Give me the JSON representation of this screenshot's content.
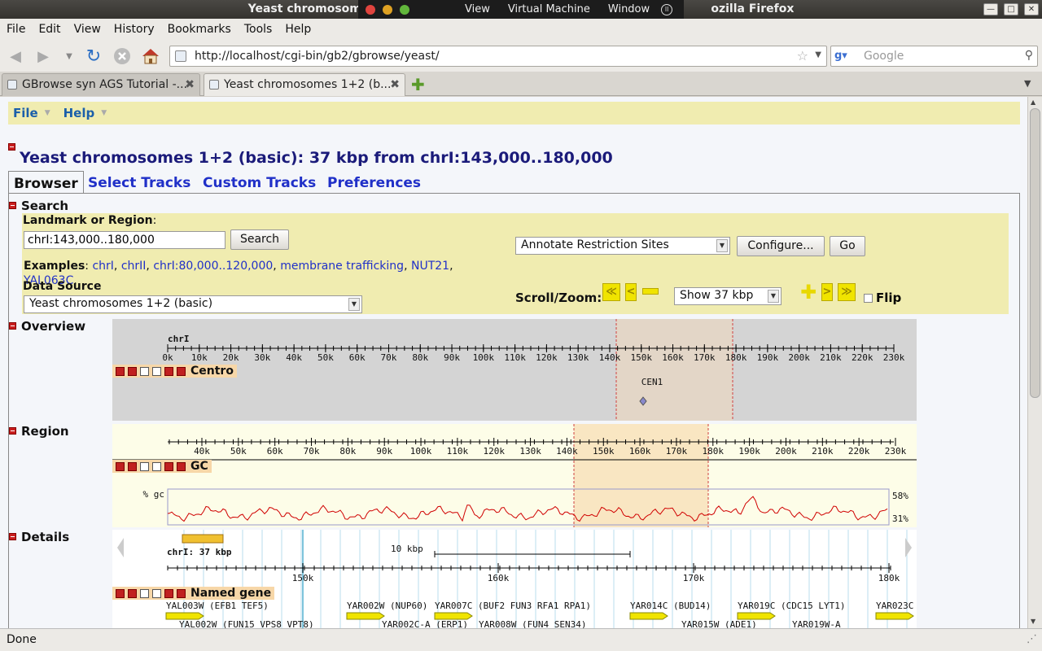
{
  "window": {
    "title": "Yeast chromosomes 1+2 (basic): 37 kbp from chrI:143,000..180,000 - Mozilla Firefox",
    "visible_title_left": "Yeast chromosome",
    "visible_title_right": "ozilla Firefox",
    "vm_menu": [
      "View",
      "Virtual Machine",
      "Window"
    ]
  },
  "menubar": [
    "File",
    "Edit",
    "View",
    "History",
    "Bookmarks",
    "Tools",
    "Help"
  ],
  "nav": {
    "url": "http://localhost/cgi-bin/gb2/gbrowse/yeast/",
    "search_placeholder": "Google"
  },
  "tabs": [
    {
      "label": "GBrowse syn AGS Tutorial -...",
      "active": false
    },
    {
      "label": "Yeast chromosomes 1+2 (b...",
      "active": true
    }
  ],
  "gbrowse": {
    "menu": [
      "File",
      "Help"
    ],
    "page_title": "Yeast chromosomes 1+2 (basic): 37 kbp from chrI:143,000..180,000",
    "tabs": [
      "Browser",
      "Select Tracks",
      "Custom Tracks",
      "Preferences"
    ],
    "search": {
      "section": "Search",
      "landmark_label": "Landmark or Region",
      "landmark_colon": ":",
      "landmark_value": "chrI:143,000..180,000",
      "search_button": "Search",
      "examples_label": "Examples",
      "examples": [
        "chrI",
        "chrII",
        "chrI:80,000..120,000",
        "membrane trafficking",
        "NUT21",
        "YAL063C"
      ],
      "data_source_label": "Data Source",
      "data_source_value": "Yeast chromosomes 1+2 (basic)",
      "plugin_value": "Annotate Restriction Sites",
      "configure_button": "Configure...",
      "go_button": "Go",
      "scroll_zoom_label": "Scroll/Zoom:",
      "zoom_value": "Show 37 kbp",
      "flip_label": "Flip",
      "flip_checked": false
    },
    "overview": {
      "section": "Overview",
      "chrom": "chrI",
      "ticks": [
        "0k",
        "10k",
        "20k",
        "30k",
        "40k",
        "50k",
        "60k",
        "70k",
        "80k",
        "90k",
        "100k",
        "110k",
        "120k",
        "130k",
        "140k",
        "150k",
        "160k",
        "170k",
        "180k",
        "190k",
        "200k",
        "210k",
        "220k",
        "230k"
      ],
      "track": "Centro",
      "feature": "CEN1"
    },
    "region": {
      "section": "Region",
      "ticks": [
        "40k",
        "50k",
        "60k",
        "70k",
        "80k",
        "90k",
        "100k",
        "110k",
        "120k",
        "130k",
        "140k",
        "150k",
        "160k",
        "170k",
        "180k",
        "190k",
        "200k",
        "210k",
        "220k",
        "230k"
      ],
      "track": "GC",
      "gc_label": "% gc",
      "gc_max": "58%",
      "gc_min": "31%"
    },
    "details": {
      "section": "Details",
      "chrom_label": "chrI: 37 kbp",
      "scale_label": "10 kbp",
      "ticks": [
        "150k",
        "160k",
        "170k",
        "180k"
      ],
      "track": "Named gene",
      "genes_row1": [
        "YAL003W (EFB1 TEF5)",
        "YAR002W (NUP60)",
        "YAR007C (BUF2 FUN3 RFA1 RPA1)",
        "YAR014C (BUD14)",
        "YAR019C (CDC15 LYT1)",
        "YAR023C"
      ],
      "genes_row2": [
        "YAL002W (FUN15 VPS8 VPT8)",
        "YAR002C-A (ERP1)",
        "YAR008W (FUN4 SEN34)",
        "YAR015W (ADE1)",
        "YAR019W-A"
      ]
    }
  },
  "status": "Done",
  "colors": {
    "gbrowse_yellow": "#f0ecb0",
    "link_blue": "#2030c8",
    "title_blue": "#1b1b7a",
    "overview_gray": "#d4d4d4",
    "highlight": "#f7d7a8",
    "gc_line": "#d00000",
    "gene_yellow": "#f0e400"
  }
}
